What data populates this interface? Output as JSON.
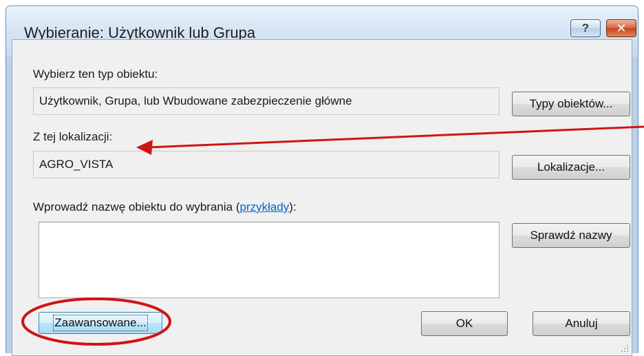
{
  "window": {
    "title": "Wybieranie: Użytkownik lub Grupa",
    "help_symbol": "?",
    "close_symbol": "✕"
  },
  "object_type": {
    "label": "Wybierz ten typ obiektu:",
    "value": "Użytkownik, Grupa, lub Wbudowane zabezpieczenie główne",
    "button": "Typy obiektów..."
  },
  "location": {
    "label": "Z tej lokalizacji:",
    "value": "AGRO_VISTA",
    "button": "Lokalizacje..."
  },
  "object_name": {
    "label_prefix": "Wprowadź nazwę obiektu do wybrania (",
    "link": "przykłady",
    "label_suffix": "):",
    "value": "",
    "check_button": "Sprawdź nazwy"
  },
  "footer": {
    "advanced_button": "Zaawansowane...",
    "ok_button": "OK",
    "cancel_button": "Anuluj"
  },
  "annotation_color": "#d01414"
}
